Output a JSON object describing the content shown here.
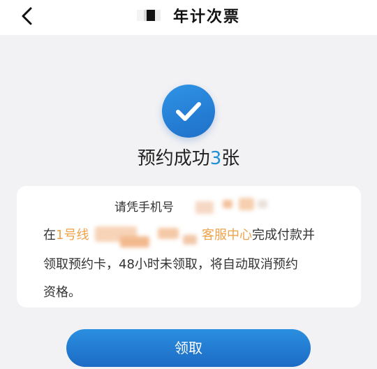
{
  "header": {
    "title": "年计次票",
    "back_icon": "chevron-left-icon"
  },
  "result": {
    "icon": "check-icon",
    "prefix": "预约成功",
    "count": "3",
    "suffix": "张"
  },
  "notice": {
    "line1": "请凭手机号",
    "line2_pre": "在",
    "line2_link_start": "1号线",
    "line2_link_end": "客服中心",
    "line2_post": "完成付款并",
    "line3": "领取预约卡，48小时未领取，将自动取消预约",
    "line4": "资格。"
  },
  "actions": {
    "claim_label": "领取"
  },
  "colors": {
    "accent_blue": "#1f6fc8",
    "highlight_orange": "#f0a24a",
    "count_blue": "#1f8fd8"
  }
}
